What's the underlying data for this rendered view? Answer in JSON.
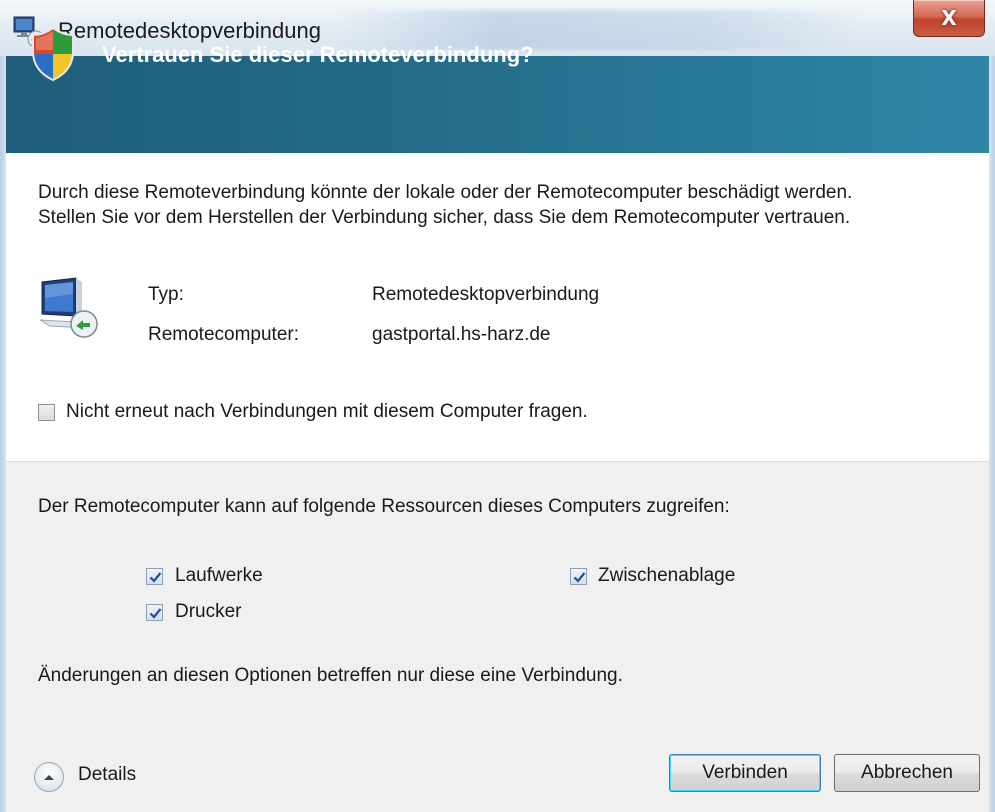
{
  "window": {
    "title": "Remotedesktopverbindung",
    "close_glyph": "X"
  },
  "banner": {
    "title": "Vertrauen Sie dieser Remoteverbindung?",
    "icon": "security-shield-icon"
  },
  "warning": {
    "line1": "Durch diese Remoteverbindung könnte der lokale oder der Remotecomputer beschädigt werden.",
    "line2": "Stellen Sie vor dem Herstellen der Verbindung sicher, dass Sie dem Remotecomputer vertrauen."
  },
  "info": {
    "icon": "remote-computer-icon",
    "type_label": "Typ:",
    "type_value": "Remotedesktopverbindung",
    "remote_label": "Remotecomputer:",
    "remote_value": "gastportal.hs-harz.de"
  },
  "dont_ask": {
    "label": "Nicht erneut nach Verbindungen mit diesem Computer fragen.",
    "checked": false
  },
  "resources": {
    "heading": "Der Remotecomputer kann auf folgende Ressourcen dieses Computers zugreifen:",
    "options": [
      {
        "label": "Laufwerke",
        "checked": true
      },
      {
        "label": "Zwischenablage",
        "checked": true
      },
      {
        "label": "Drucker",
        "checked": true
      }
    ],
    "note": "Änderungen an diesen Optionen betreffen nur diese eine Verbindung."
  },
  "footer": {
    "details_label": "Details",
    "connect_label": "Verbinden",
    "cancel_label": "Abbrechen"
  },
  "colors": {
    "banner": "#246b88",
    "lower_panel": "#f0f0f0",
    "close_button": "#c0442c"
  }
}
